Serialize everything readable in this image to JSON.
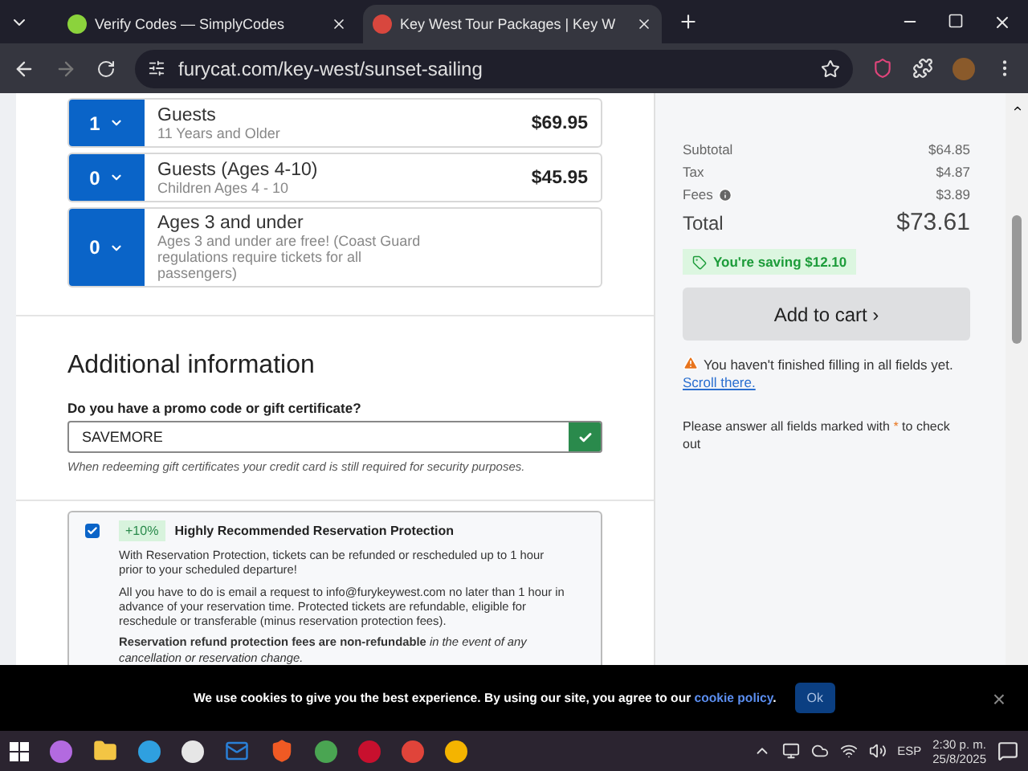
{
  "browser": {
    "tabs": [
      {
        "title": "Verify Codes — SimplyCodes",
        "selected": false
      },
      {
        "title": "Key West Tour Packages | Key W",
        "selected": true
      }
    ],
    "url": "furycat.com/key-west/sunset-sailing"
  },
  "tickets": [
    {
      "qty": "1",
      "name": "Guests",
      "desc": "11 Years and Older",
      "price": "$69.95"
    },
    {
      "qty": "0",
      "name": "Guests (Ages 4-10)",
      "desc": "Children Ages 4 - 10",
      "price": "$45.95"
    },
    {
      "qty": "0",
      "name": "Ages 3 and under",
      "desc": "Ages 3 and under are free! (Coast Guard regulations require tickets for all passengers)"
    }
  ],
  "additional": {
    "heading": "Additional information",
    "promo_label": "Do you have a promo code or gift certificate?",
    "promo_value": "SAVEMORE",
    "promo_valid": true,
    "promo_hint": "When redeeming gift certificates your credit card is still required for security purposes."
  },
  "protection": {
    "checked": true,
    "badge": "+10%",
    "title": "Highly Recommended Reservation Protection",
    "paragraphs": [
      "With Reservation Protection, tickets can be refunded or rescheduled up to 1 hour prior to your scheduled departure!",
      "All you have to do is email a request to info@furykeywest.com no later than 1 hour in advance of your reservation time. Protected tickets are refundable, eligible for reschedule or transferable (minus reservation protection fees).",
      "**Reservation refund protection fees are non-refundable** *in the event of any cancellation or reservation change.*"
    ]
  },
  "summary": {
    "lines": [
      {
        "label": "Subtotal",
        "value": "$64.85",
        "info": false
      },
      {
        "label": "Tax",
        "value": "$4.87",
        "info": false
      },
      {
        "label": "Fees",
        "value": "$3.89",
        "info": true
      }
    ],
    "total_label": "Total",
    "total_value": "$73.61",
    "saving": "You're saving $12.10",
    "button": "Add to cart ›",
    "warning": "You haven't finished filling in all fields yet.",
    "warning_link": "Scroll there.",
    "note_before": "Please answer all fields marked with",
    "note_mark": "*",
    "note_after": "to check out"
  },
  "cookie": {
    "text": "We use cookies to give you the best experience. By using our site, you agree to our",
    "link": "cookie policy",
    "after": ".",
    "button": "Ok",
    "close": "×"
  },
  "taskbar": {
    "language": "ESP",
    "time": "2:30 p. m.",
    "date": "25/8/2025"
  }
}
